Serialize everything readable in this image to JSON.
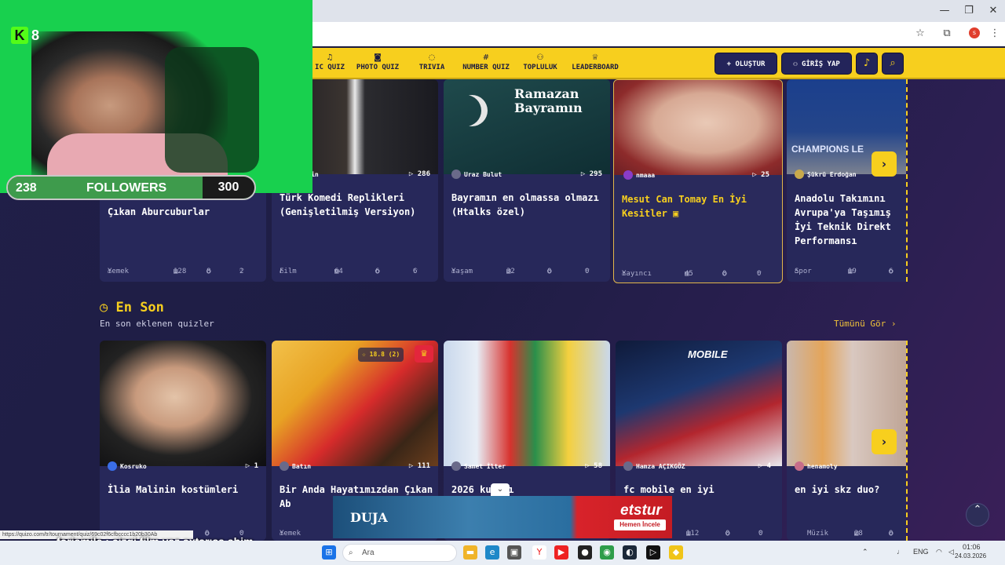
{
  "browser": {
    "star_icon": "star-icon",
    "extensions_icon": "puzzle-icon",
    "profile_initial": "s",
    "menu_icon": "kebab-icon"
  },
  "nav": {
    "items": [
      {
        "label": "IC QUIZ",
        "icon": "music-icon"
      },
      {
        "label": "PHOTO QUIZ",
        "icon": "camera-icon"
      },
      {
        "label": "TRIVIA",
        "icon": "chat-icon"
      },
      {
        "label": "NUMBER QUIZ",
        "icon": "hash-icon"
      },
      {
        "label": "TOPLULUK",
        "icon": "people-icon"
      },
      {
        "label": "LEADERBOARD",
        "icon": "trophy-icon"
      }
    ],
    "create_label": "+ OLUŞTUR",
    "login_label": "GİRİŞ YAP"
  },
  "popular": {
    "cards": [
      {
        "author": "",
        "plays": "",
        "title": "Çıkan Aburcuburlar",
        "category": "Yemek",
        "questions": "128",
        "comments": "8",
        "likes": "2"
      },
      {
        "author": "n Levin",
        "plays": "286",
        "title": "Türk Komedi Replikleri (Genişletilmiş Versiyon)",
        "category": "Film",
        "questions": "64",
        "comments": "6",
        "likes": "6"
      },
      {
        "author": "Uraz Bulut",
        "plays": "295",
        "title": "Bayramın en olmassa olmazı (Htalks özel)",
        "category": "Yaşam",
        "questions": "32",
        "comments": "0",
        "likes": "0",
        "thumb_text": "Ramazan Bayramın"
      },
      {
        "author": "nmaaa",
        "plays": "25",
        "title": "Mesut Can Tomay En İyi Kesitler",
        "category": "Yayıncı",
        "questions": "45",
        "comments": "0",
        "likes": "0"
      },
      {
        "author": "Şükrü Erdoğan",
        "plays": "",
        "title": "Anadolu Takımını Avrupa'ya Taşımış İyi Teknik Direkt Performansı",
        "category": "Spor",
        "questions": "19",
        "comments": "6",
        "likes": "",
        "thumb_text": "CHAMPIONS LE"
      }
    ]
  },
  "latest": {
    "title": "En Son",
    "subtitle": "En son eklenen quizler",
    "see_all": "Tümünü Gör",
    "cards": [
      {
        "author": "Kosruko",
        "plays": "1",
        "title": "İlia Malinin kostümleri",
        "category": "",
        "questions": "",
        "comments": "0",
        "likes": "0"
      },
      {
        "author": "Batın",
        "plays": "111",
        "title": "Bir Anda Hayatımızdan Çıkan Ab",
        "category": "Yemek",
        "questions": "",
        "comments": "",
        "likes": "",
        "rating": "18.8 (2)"
      },
      {
        "author": "Samet İlter",
        "plays": "58",
        "title": "2026 kupası",
        "category": "",
        "questions": "",
        "comments": "",
        "likes": ""
      },
      {
        "author": "Hamza AÇIKGÖZ",
        "plays": "4",
        "title": "fc mobile en iyi",
        "category": "",
        "questions": "112",
        "comments": "0",
        "likes": "0",
        "thumb_text": "MOBILE"
      },
      {
        "author": "henamoly",
        "plays": "",
        "title": "en iyi skz duo?",
        "category": "Müzik",
        "questions": "28",
        "comments": "0",
        "likes": ""
      }
    ]
  },
  "overlay": {
    "kick_count": "8",
    "followers_current": "238",
    "followers_label": "FOLLOWERS",
    "followers_goal": "300",
    "followers_progress": 0.79,
    "chat_text": "forismile : çizgi film yaz axtarışa abim",
    "status_url": "https://quizo.com/tr/tournament/quiz/69c02f6cfbcccc1b20b30Ab"
  },
  "ad": {
    "brand1": "DUJA",
    "brand2": "etstur",
    "cta": "Hemen İncele"
  },
  "taskbar": {
    "search_placeholder": "Ara",
    "lang": "ENG",
    "time": "01:06",
    "date": "24.03.2026"
  },
  "colors": {
    "accent": "#f7cf1e",
    "bg": "#1e1d44",
    "card": "#27285a"
  }
}
